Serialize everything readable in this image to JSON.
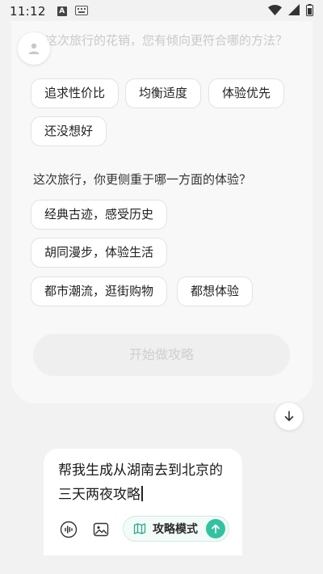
{
  "status_bar": {
    "time": "11:12",
    "icons": [
      "a-badge-icon",
      "keyboard-icon",
      "wifi-icon",
      "signal-icon",
      "battery-icon"
    ]
  },
  "question_card": {
    "q1_text": "在这次旅行的花销，您有倾向更符合哪的方法？",
    "q1_options": [
      "追求性价比",
      "均衡适度",
      "体验优先",
      "还没想好"
    ],
    "q2_label": "这次旅行，你更侧重于哪一方面的体验？",
    "q2_options": [
      "经典古迹，感受历史",
      "胡同漫步，体验生活",
      "都市潮流，逛街购物",
      "都想体验"
    ],
    "start_button": "开始做攻略"
  },
  "input": {
    "value": "帮我生成从湖南去到北京的三天两夜攻略",
    "mode_label": "攻略模式"
  },
  "colors": {
    "accent": "#33c2a0",
    "page_bg": "#f2f2f2",
    "card_bg": "#f8f8f8",
    "chip_border": "#e3e3e3",
    "disabled_text": "#cfcfcf"
  }
}
